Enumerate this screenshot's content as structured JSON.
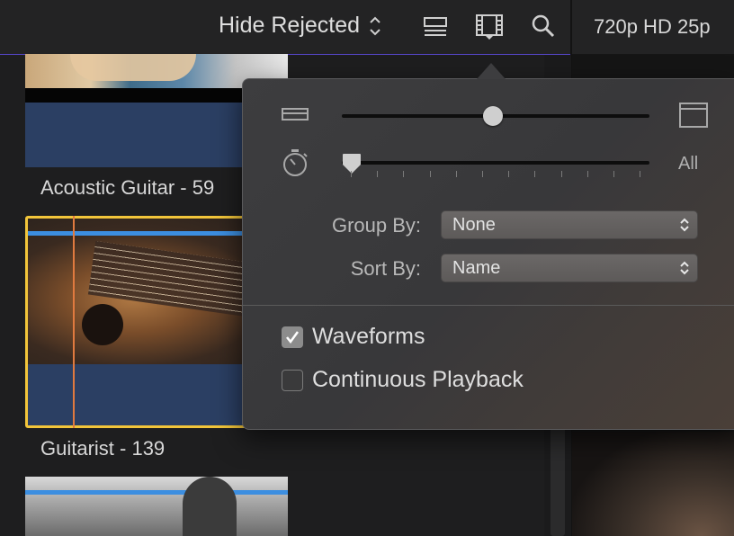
{
  "toolbar": {
    "filter_label": "Hide Rejected",
    "format_label": "720p HD 25p"
  },
  "clips": [
    {
      "label": "Acoustic Guitar - 59"
    },
    {
      "label": "Guitarist - 139"
    },
    {
      "label": ""
    }
  ],
  "popover": {
    "clip_height_level": 0.49,
    "duration_level": 0.0,
    "duration_end_label": "All",
    "group_by_label": "Group By:",
    "group_by_value": "None",
    "sort_by_label": "Sort By:",
    "sort_by_value": "Name",
    "waveforms_label": "Waveforms",
    "waveforms_checked": true,
    "continuous_label": "Continuous Playback",
    "continuous_checked": false
  },
  "colors": {
    "selection_border": "#f2c53a",
    "playhead": "#e07a3f",
    "audio_lane": "#2b3f63",
    "toolbar_accent_line": "#5646c9"
  }
}
